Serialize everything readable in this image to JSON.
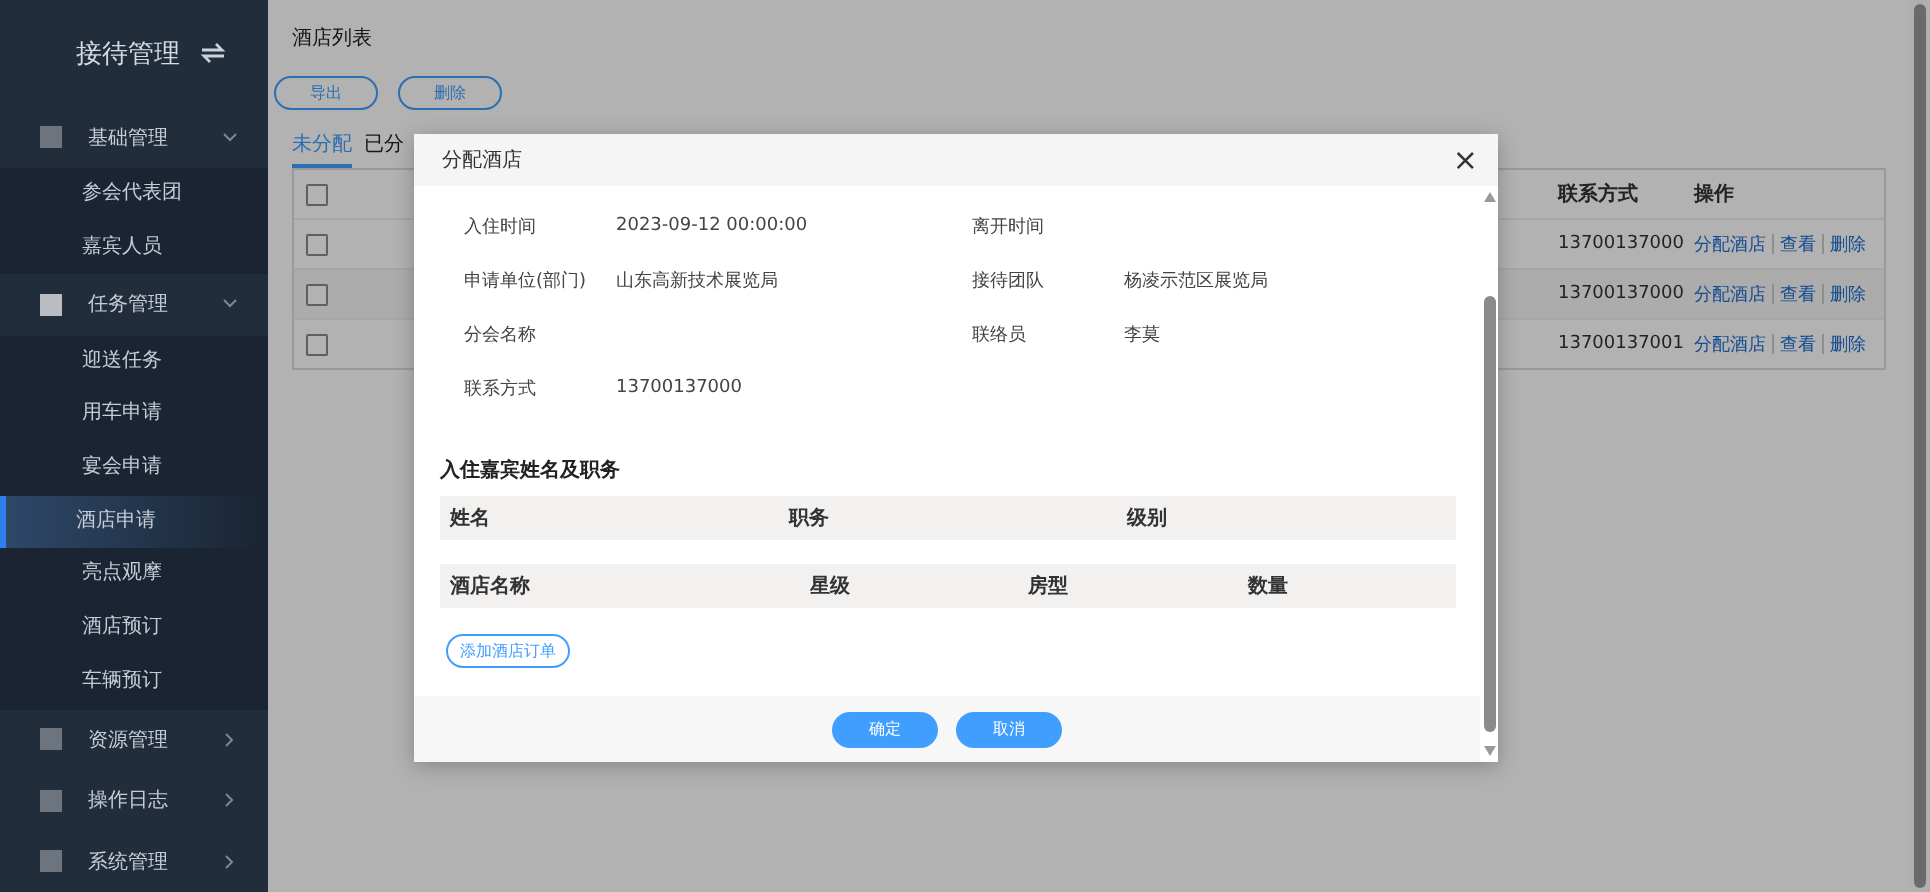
{
  "sidebar": {
    "title": "接待管理",
    "groups": [
      {
        "label": "基础管理",
        "expanded": true,
        "active": false,
        "children": [
          {
            "label": "参会代表团",
            "selected": false
          },
          {
            "label": "嘉宾人员",
            "selected": false
          }
        ]
      },
      {
        "label": "任务管理",
        "expanded": true,
        "active": true,
        "children": [
          {
            "label": "迎送任务",
            "selected": false
          },
          {
            "label": "用车申请",
            "selected": false
          },
          {
            "label": "宴会申请",
            "selected": false
          },
          {
            "label": "酒店申请",
            "selected": true
          },
          {
            "label": "亮点观摩",
            "selected": false
          },
          {
            "label": "酒店预订",
            "selected": false
          },
          {
            "label": "车辆预订",
            "selected": false
          }
        ]
      },
      {
        "label": "资源管理",
        "expanded": false,
        "active": false
      },
      {
        "label": "操作日志",
        "expanded": false,
        "active": false
      },
      {
        "label": "系统管理",
        "expanded": false,
        "active": false
      }
    ]
  },
  "page": {
    "title": "酒店列表",
    "buttons": [
      "导出",
      "删除"
    ],
    "tabs": [
      {
        "label": "未分配",
        "selected": true
      },
      {
        "label": "已分",
        "selected": false
      }
    ],
    "table": {
      "select_all_checked": false,
      "columns": [
        "联系方式",
        "操作"
      ],
      "rows": [
        {
          "checked": false,
          "contact": "13700137000",
          "actions": [
            "分配酒店",
            "查看",
            "删除"
          ]
        },
        {
          "checked": false,
          "contact": "13700137000",
          "actions": [
            "分配酒店",
            "查看",
            "删除"
          ]
        },
        {
          "checked": false,
          "contact": "13700137001",
          "actions": [
            "分配酒店",
            "查看",
            "删除"
          ]
        }
      ]
    }
  },
  "dialog": {
    "title": "分配酒店",
    "close": "×",
    "fields": [
      {
        "label": "入住时间",
        "value": "2023-09-12 00:00:00"
      },
      {
        "label": "离开时间"
      },
      {
        "label": "申请单位(部门)",
        "value": "山东高新技术展览局"
      },
      {
        "label": "接待团队",
        "value": "杨凌示范区展览局"
      },
      {
        "label": "分会名称"
      },
      {
        "label": "联络员",
        "value": "李莫"
      },
      {
        "label": "联系方式",
        "value": "13700137000"
      }
    ],
    "guest_section": {
      "title": "入住嘉宾姓名及职务",
      "columns": [
        "姓名",
        "职务",
        "级别"
      ]
    },
    "hotel_table": {
      "columns": [
        "酒店名称",
        "星级",
        "房型",
        "数量"
      ]
    },
    "add_button": "添加酒店订单",
    "buttons": [
      "确定",
      "取消"
    ]
  }
}
